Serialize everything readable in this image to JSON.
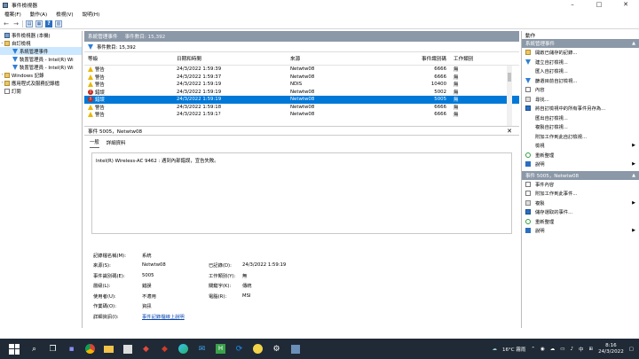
{
  "window": {
    "title": "事件檢視器",
    "minimize": "–",
    "maximize": "□",
    "close": "✕"
  },
  "menu": [
    "檔案(F)",
    "動作(A)",
    "檢視(V)",
    "說明(H)"
  ],
  "tree": {
    "root": "事件檢視器 (本機)",
    "custom_views": "自訂檢視",
    "admin_events": "系統管理事件",
    "filter1": "裝置管理員 - Intel(R) Wi",
    "filter2": "裝置管理員 - Intel(R) Wi",
    "windows_logs": "Windows 記錄",
    "app_logs": "應用程式及服務記錄檔",
    "subscriptions": "訂閱"
  },
  "list": {
    "title": "系統管理事件",
    "count": "事件數目: 15,392",
    "count2": "事件數目: 15,392",
    "headers": [
      "等級",
      "日期和時間",
      "來源",
      "事件識別碼",
      "工作類別"
    ],
    "rows": [
      {
        "level": "警告",
        "type": "warn",
        "date": "24/3/2022 1:59:39",
        "source": "Netwtw08",
        "id": "6666",
        "task": "無"
      },
      {
        "level": "警告",
        "type": "warn",
        "date": "24/3/2022 1:59:37",
        "source": "Netwtw08",
        "id": "6666",
        "task": "無"
      },
      {
        "level": "警告",
        "type": "warn",
        "date": "24/3/2022 1:59:19",
        "source": "NDIS",
        "id": "10400",
        "task": "無"
      },
      {
        "level": "錯誤",
        "type": "err",
        "date": "24/3/2022 1:59:19",
        "source": "Netwtw08",
        "id": "5002",
        "task": "無"
      },
      {
        "level": "錯誤",
        "type": "err",
        "date": "24/3/2022 1:59:19",
        "source": "Netwtw08",
        "id": "5005",
        "task": "無"
      },
      {
        "level": "警告",
        "type": "warn",
        "date": "24/3/2022 1:59:18",
        "source": "Netwtw08",
        "id": "6666",
        "task": "無"
      },
      {
        "level": "警告",
        "type": "warn",
        "date": "24/3/2022 1:59:1?",
        "source": "Netwtw08",
        "id": "6666",
        "task": "無"
      }
    ]
  },
  "detail": {
    "title": "事件 5005，Netwtw08",
    "tab_general": "一般",
    "tab_details": "詳細資料",
    "description": "Intel(R) Wireless-AC 9462 : 遇到內部錯誤，宣告失敗。",
    "props": {
      "log_name_label": "記錄檔名稱(M):",
      "log_name": "系統",
      "source_label": "來源(S):",
      "source": "Netwtw08",
      "logged_label": "已記錄(D):",
      "logged": "24/3/2022 1:59:19",
      "event_id_label": "事件識別碼(E):",
      "event_id": "5005",
      "task_label": "工作類別(Y):",
      "task": "無",
      "level_label": "層級(L):",
      "level": "錯誤",
      "keywords_label": "關鍵字(K):",
      "keywords": "傳統",
      "user_label": "使用者(U):",
      "user": "不適用",
      "computer_label": "電腦(R):",
      "computer": "MSI",
      "opcode_label": "作業碼(O):",
      "opcode": "資訊",
      "more_info_label": "詳細資訊(I):",
      "more_info": "事件記錄檔線上說明"
    }
  },
  "actions": {
    "title": "動作",
    "section1": "系統管理事件",
    "items1": [
      "開啟已儲存的記錄...",
      "建立自訂檢視...",
      "匯入自訂檢視...",
      "篩選目前自訂檢視...",
      "內容",
      "尋找...",
      "將自訂檢視中的所有事件另存為...",
      "匯出自訂檢視...",
      "複製自訂檢視...",
      "附加工作到此自訂檢視...",
      "檢視",
      "重新整理",
      "說明"
    ],
    "section2": "事件 5005，Netwtw08",
    "items2": [
      "事件內容",
      "附加工作到此事件...",
      "複製",
      "儲存選取的事件...",
      "重新整理",
      "說明"
    ]
  },
  "taskbar": {
    "weather": "16°C 霧雨",
    "lang": "中",
    "time": "8:16",
    "date": "24/3/2022"
  }
}
